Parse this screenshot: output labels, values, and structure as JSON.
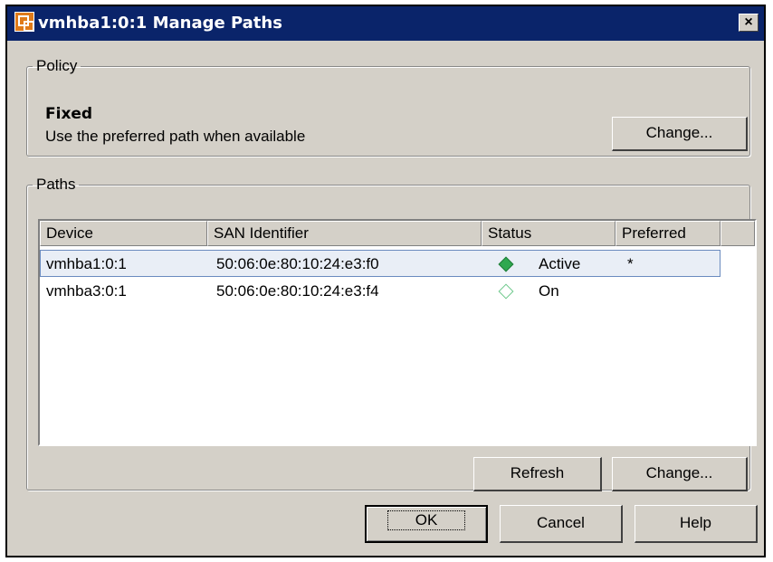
{
  "window": {
    "title": "vmhba1:0:1 Manage Paths",
    "close_label": "×"
  },
  "policy": {
    "legend": "Policy",
    "name": "Fixed",
    "description": "Use the preferred path when available",
    "change_label": "Change..."
  },
  "paths": {
    "legend": "Paths",
    "columns": [
      "Device",
      "SAN Identifier",
      "Status",
      "Preferred"
    ],
    "rows": [
      {
        "device": "vmhba1:0:1",
        "san": "50:06:0e:80:10:24:e3:f0",
        "status": "Active",
        "status_icon": "active-diamond-icon",
        "preferred": "*"
      },
      {
        "device": "vmhba3:0:1",
        "san": "50:06:0e:80:10:24:e3:f4",
        "status": "On",
        "status_icon": "on-diamond-icon",
        "preferred": ""
      }
    ],
    "refresh_label": "Refresh",
    "change_label": "Change..."
  },
  "footer": {
    "ok_label": "OK",
    "cancel_label": "Cancel",
    "help_label": "Help"
  },
  "colors": {
    "titlebar": "#0a246a",
    "active": "#2fa84f",
    "on": "#6cc88a",
    "dialog_bg": "#d4d0c8"
  }
}
